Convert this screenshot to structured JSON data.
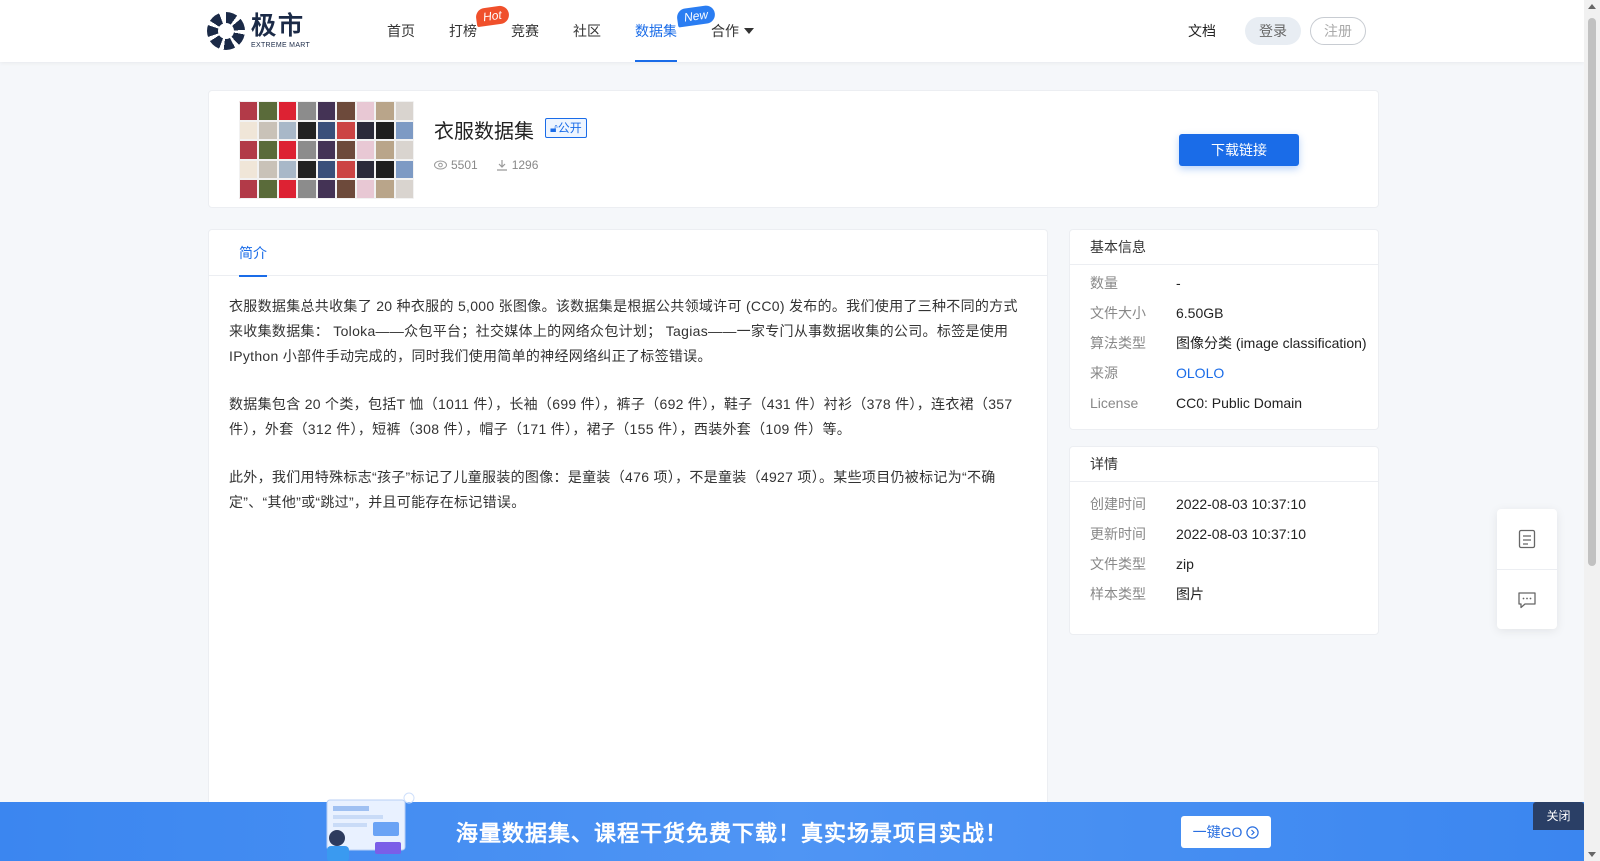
{
  "logo": {
    "cn": "极市",
    "en": "EXTREME MART"
  },
  "nav": {
    "items": [
      {
        "label": "首页"
      },
      {
        "label": "打榜",
        "badge": "Hot"
      },
      {
        "label": "竞赛"
      },
      {
        "label": "社区"
      },
      {
        "label": "数据集",
        "badge": "New",
        "active": true
      },
      {
        "label": "合作"
      }
    ]
  },
  "header": {
    "doc": "文档",
    "login": "登录",
    "register": "注册"
  },
  "dataset": {
    "title": "衣服数据集",
    "visibility": "公开",
    "views": "5501",
    "downloads": "1296",
    "download_button": "下载链接"
  },
  "tabs": {
    "intro": "简介"
  },
  "description": {
    "p1": "衣服数据集总共收集了 20 种衣服的 5,000 张图像。该数据集是根据公共领域许可 (CC0) 发布的。我们使用了三种不同的方式来收集数据集： Toloka——众包平台；社交媒体上的网络众包计划； Tagias——一家专门从事数据收集的公司。标签是使用 IPython 小部件手动完成的，同时我们使用简单的神经网络纠正了标签错误。",
    "p2": "数据集包含 20 个类，包括T 恤（1011 件），长袖（699 件），裤子（692 件），鞋子（431 件）衬衫（378 件），连衣裙（357 件），外套（312 件），短裤（308 件），帽子（171 件），裙子（155 件），西装外套（109 件）等。",
    "p3": "此外，我们用特殊标志“孩子”标记了儿童服装的图像：是童装（476 项），不是童装（4927 项）。某些项目仍被标记为“不确定”、“其他”或“跳过”，并且可能存在标记错误。"
  },
  "basic_info": {
    "title": "基本信息",
    "rows": [
      {
        "key": "数量",
        "value": "-"
      },
      {
        "key": "文件大小",
        "value": "6.50GB"
      },
      {
        "key": "算法类型",
        "value": "图像分类 (image classification)"
      },
      {
        "key": "来源",
        "value": "OLOLO"
      },
      {
        "key": "License",
        "value": "CC0: Public Domain"
      }
    ]
  },
  "details": {
    "title": "详情",
    "rows": [
      {
        "key": "创建时间",
        "value": "2022-08-03 10:37:10"
      },
      {
        "key": "更新时间",
        "value": "2022-08-03 10:37:10"
      },
      {
        "key": "文件类型",
        "value": "zip"
      },
      {
        "key": "样本类型",
        "value": "图片"
      }
    ]
  },
  "banner": {
    "text": "海量数据集、课程干货免费下载！真实场景项目实战！",
    "go": "一键GO",
    "close": "关闭"
  },
  "colors": {
    "accent": "#1a6ce8",
    "hot": "#f0502b",
    "banner": "#4f95f4"
  }
}
